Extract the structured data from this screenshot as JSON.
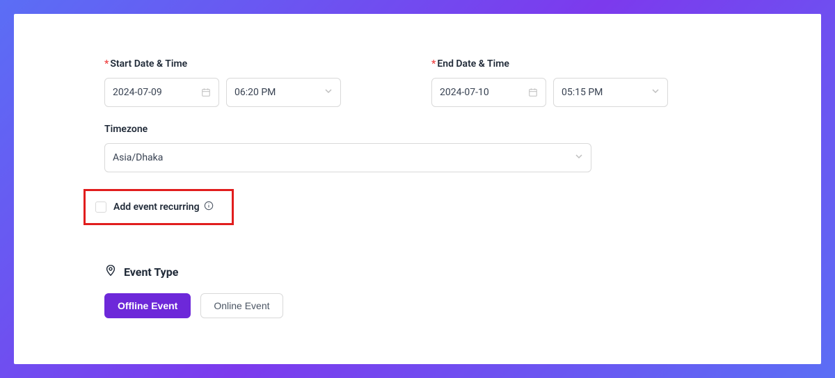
{
  "dateTime": {
    "start": {
      "label": "Start Date & Time",
      "date": "2024-07-09",
      "time": "06:20 PM",
      "required": true
    },
    "end": {
      "label": "End Date & Time",
      "date": "2024-07-10",
      "time": "05:15 PM",
      "required": true
    }
  },
  "timezone": {
    "label": "Timezone",
    "value": "Asia/Dhaka"
  },
  "recurring": {
    "label": "Add event recurring",
    "checked": false
  },
  "eventType": {
    "heading": "Event Type",
    "buttons": {
      "offline": "Offline Event",
      "online": "Online Event"
    },
    "selected": "offline"
  },
  "colors": {
    "accent": "#6d28d9",
    "required": "#ef4444",
    "highlight": "#e11d1d"
  }
}
